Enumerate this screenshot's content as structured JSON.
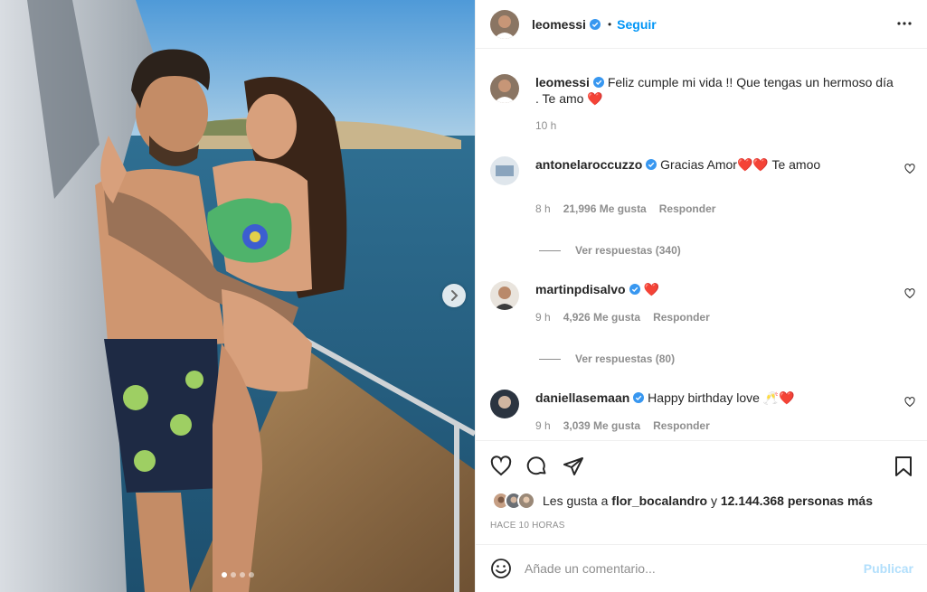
{
  "header": {
    "username": "leomessi",
    "follow_label": "Seguir",
    "bullet": "•"
  },
  "caption": {
    "username": "leomessi",
    "text": "Feliz cumple mi vida !! Que tengas un hermoso día . Te amo ❤️",
    "time": "10 h"
  },
  "comments": [
    {
      "username": "antonelaroccuzzo",
      "text": "Gracias Amor❤️❤️ Te amoo",
      "time": "8 h",
      "likes": "21,996 Me gusta",
      "reply_label": "Responder",
      "view_replies": "Ver respuestas (340)"
    },
    {
      "username": "martinpdisalvo",
      "text": "❤️",
      "time": "9 h",
      "likes": "4,926 Me gusta",
      "reply_label": "Responder",
      "view_replies": "Ver respuestas (80)"
    },
    {
      "username": "daniellasemaan",
      "text": "Happy birthday love 🥂❤️",
      "time": "9 h",
      "likes": "3,039 Me gusta",
      "reply_label": "Responder"
    }
  ],
  "likes": {
    "prefix": "Les gusta a",
    "user": "flor_bocalandro",
    "connector": "y",
    "count": "12.144.368 personas más"
  },
  "timestamp": "HACE 10 HORAS",
  "add_comment": {
    "placeholder": "Añade un comentario...",
    "publish_label": "Publicar"
  },
  "carousel": {
    "slide_count": 4,
    "active_index": 0
  },
  "colors": {
    "accent": "#0095f6",
    "verified": "#3897f0",
    "heart": "#ed4956",
    "muted": "#8e8e8e"
  }
}
